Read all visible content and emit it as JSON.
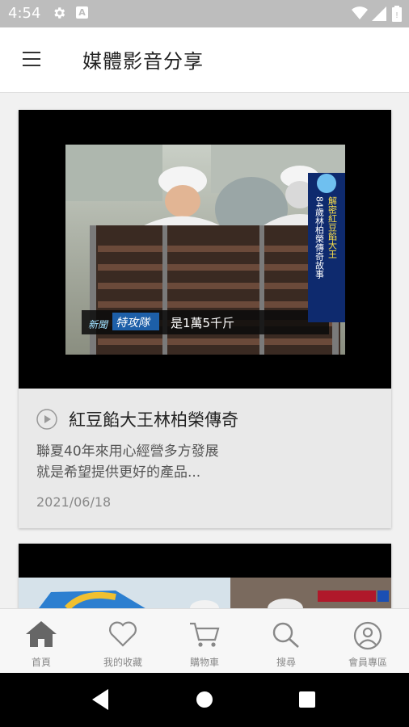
{
  "status_bar": {
    "time": "4:54"
  },
  "app_bar": {
    "title": "媒體影音分享"
  },
  "cards": [
    {
      "title": "紅豆餡大王林柏榮傳奇",
      "description_line1": "聯夏40年來用心經營多方發展",
      "description_line2": "就是希望提供更好的產品...",
      "date": "2021/06/18",
      "thumbnail": {
        "caption": "是1萬5千斤",
        "badge": "特攻隊",
        "badge_prefix": "新聞",
        "vertical_title": "解密紅豆餡大王",
        "vertical_sub": "84歲林柏榮傳奇故事"
      }
    },
    {
      "thumbnail": {}
    }
  ],
  "bottom_nav": [
    {
      "label": "首頁",
      "icon": "home-icon",
      "active": true
    },
    {
      "label": "我的收藏",
      "icon": "heart-icon"
    },
    {
      "label": "購物車",
      "icon": "cart-icon"
    },
    {
      "label": "搜尋",
      "icon": "search-icon"
    },
    {
      "label": "會員專區",
      "icon": "user-icon"
    }
  ],
  "colors": {
    "status_bar": "#bdbdbd",
    "card_bg": "#e9e9e9",
    "nav_active": "#666666",
    "nav_inactive": "#888888"
  }
}
